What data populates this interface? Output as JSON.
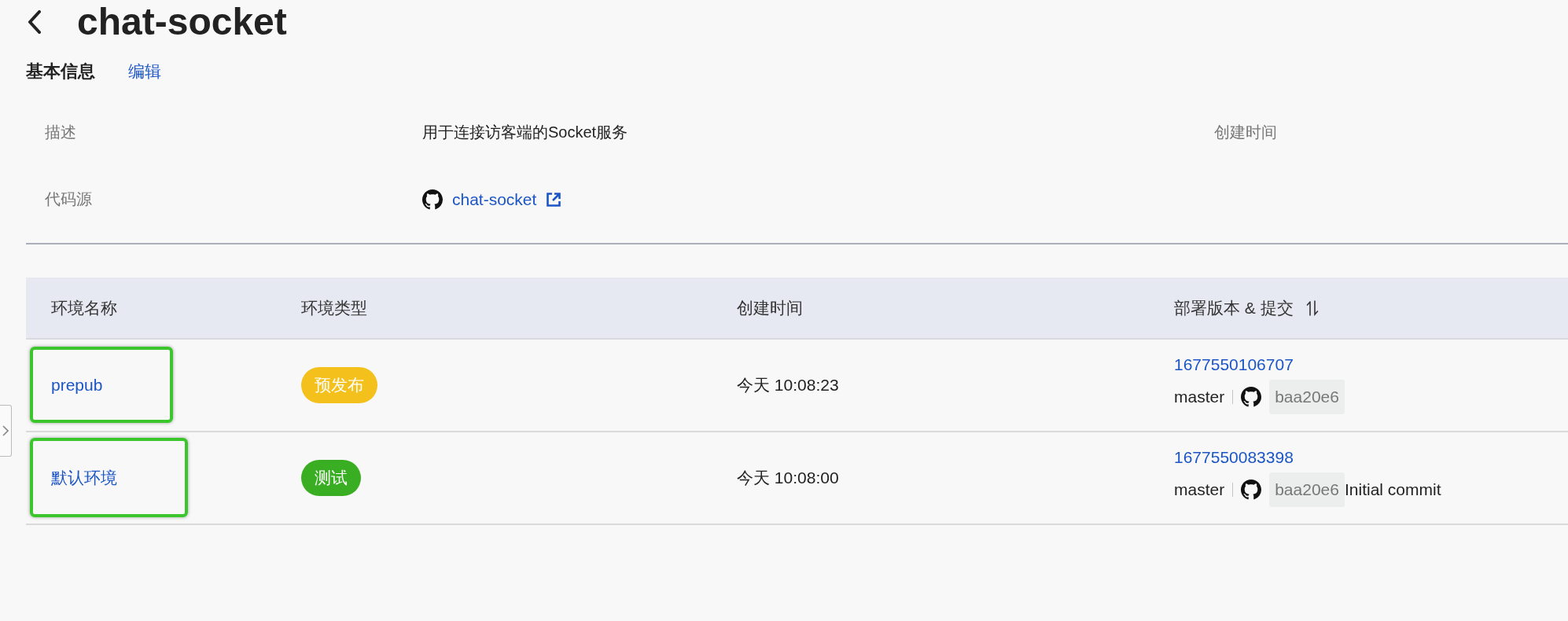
{
  "header": {
    "title": "chat-socket"
  },
  "basic_info": {
    "title": "基本信息",
    "edit_link": "编辑",
    "fields": [
      {
        "label": "描述",
        "kind": "text",
        "value": "用于连接访客端的Socket服务"
      },
      {
        "label": "创建时间",
        "kind": "empty"
      },
      {
        "label": "代码源",
        "kind": "repo",
        "value": "chat-socket"
      }
    ]
  },
  "table": {
    "columns": [
      {
        "label": "环境名称",
        "kind": "plain"
      },
      {
        "label": "环境类型",
        "kind": "plain"
      },
      {
        "label": "创建时间",
        "kind": "plain"
      },
      {
        "label": "部署版本 & 提交",
        "kind": "sortable"
      }
    ],
    "rows": [
      {
        "name": "prepub",
        "annotated": true,
        "type": {
          "label": "预发布",
          "color": "#f4c01b"
        },
        "created": "今天 10:08:23",
        "version": "1677550106707",
        "branch": "master",
        "commit": "baa20e6"
      },
      {
        "name": "默认环境",
        "annotated": true,
        "type": {
          "label": "测试",
          "color": "#3aae22"
        },
        "created": "今天 10:08:00",
        "version": "1677550083398",
        "branch": "master",
        "commit": "baa20e6",
        "message": "Initial commit"
      }
    ]
  }
}
